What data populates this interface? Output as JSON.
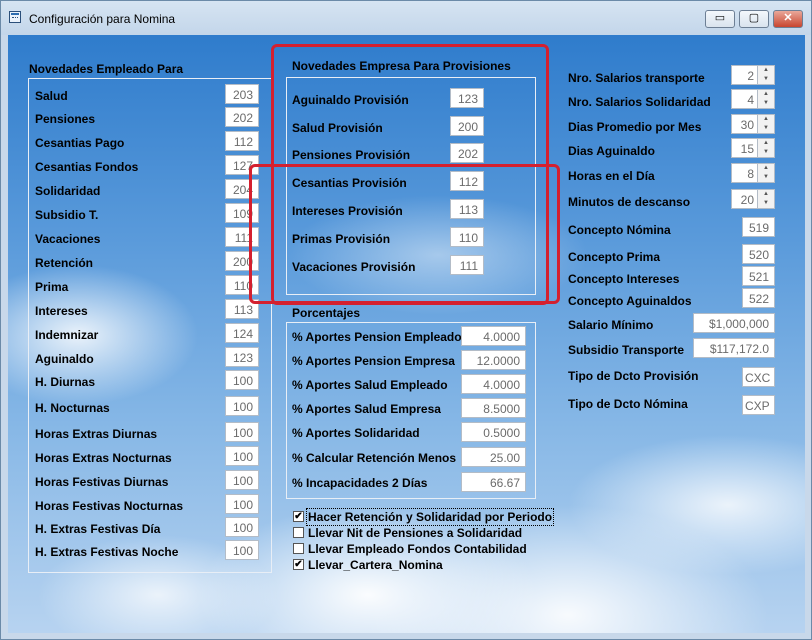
{
  "window": {
    "title": "Configuración para Nomina"
  },
  "empleado": {
    "title": "Novedades Empleado Para",
    "items": [
      {
        "label": "Salud",
        "value": "203"
      },
      {
        "label": "Pensiones",
        "value": "202"
      },
      {
        "label": "Cesantias Pago",
        "value": "112"
      },
      {
        "label": "Cesantias Fondos",
        "value": "127"
      },
      {
        "label": "Solidaridad",
        "value": "204"
      },
      {
        "label": "Subsidio T.",
        "value": "109"
      },
      {
        "label": "Vacaciones",
        "value": "111"
      },
      {
        "label": "Retención",
        "value": "200"
      },
      {
        "label": "Prima",
        "value": "110"
      },
      {
        "label": "Intereses",
        "value": "113"
      },
      {
        "label": "Indemnizar",
        "value": "124"
      },
      {
        "label": "Aguinaldo",
        "value": "123"
      },
      {
        "label": "H. Diurnas",
        "value": "100"
      },
      {
        "label": "H. Nocturnas",
        "value": "100"
      },
      {
        "label": "Horas Extras Diurnas",
        "value": "100"
      },
      {
        "label": "Horas Extras Nocturnas",
        "value": "100"
      },
      {
        "label": "Horas Festivas Diurnas",
        "value": "100"
      },
      {
        "label": "Horas Festivas Nocturnas",
        "value": "100"
      },
      {
        "label": "H. Extras Festivas Día",
        "value": "100"
      },
      {
        "label": "H. Extras Festivas Noche",
        "value": "100"
      }
    ]
  },
  "empresa": {
    "title": "Novedades Empresa Para Provisiones",
    "items": [
      {
        "label": "Aguinaldo Provisión",
        "value": "123"
      },
      {
        "label": "Salud Provisión",
        "value": "200"
      },
      {
        "label": "Pensiones Provisión",
        "value": "202"
      },
      {
        "label": "Cesantias Provisión",
        "value": "112"
      },
      {
        "label": "Intereses Provisión",
        "value": "113"
      },
      {
        "label": "Primas Provisión",
        "value": "110"
      },
      {
        "label": "Vacaciones Provisión",
        "value": "111"
      }
    ]
  },
  "porcentajes": {
    "title": "Porcentajes",
    "items": [
      {
        "label": "% Aportes Pension Empleado",
        "value": "4.0000"
      },
      {
        "label": "% Aportes Pension Empresa",
        "value": "12.0000"
      },
      {
        "label": "% Aportes Salud Empleado",
        "value": "4.0000"
      },
      {
        "label": "% Aportes Salud Empresa",
        "value": "8.5000"
      },
      {
        "label": "% Aportes Solidaridad",
        "value": "0.5000"
      },
      {
        "label": "% Calcular Retención Menos",
        "value": "25.00"
      },
      {
        "label": "% Incapacidades 2 Días",
        "value": "66.67"
      }
    ]
  },
  "checkboxes": [
    {
      "label": "Hacer Retención y Solidaridad por Periodo",
      "checked": true,
      "mark": "✔"
    },
    {
      "label": "Llevar Nit de Pensiones a Solidaridad",
      "checked": false,
      "mark": ""
    },
    {
      "label": "Llevar Empleado Fondos Contabilidad",
      "checked": false,
      "mark": ""
    },
    {
      "label": "Llevar_Cartera_Nomina",
      "checked": true,
      "mark": "✔"
    }
  ],
  "right": {
    "spinners": [
      {
        "label": "Nro. Salarios transporte",
        "value": "2"
      },
      {
        "label": "Nro. Salarios Solidaridad",
        "value": "4"
      },
      {
        "label": "Dias Promedio por Mes",
        "value": "30"
      },
      {
        "label": "Dias Aguinaldo",
        "value": "15"
      },
      {
        "label": "Horas en el Día",
        "value": "8"
      },
      {
        "label": "Minutos de descanso",
        "value": "20"
      }
    ],
    "conceptos": [
      {
        "label": "Concepto Nómina",
        "value": "519"
      },
      {
        "label": "Concepto Prima",
        "value": "520"
      },
      {
        "label": "Concepto Intereses",
        "value": "521"
      },
      {
        "label": "Concepto Aguinaldos",
        "value": "522"
      }
    ],
    "montos": [
      {
        "label": "Salario Mínimo",
        "value": "$1,000,000"
      },
      {
        "label": "Subsidio Transporte",
        "value": "$117,172.0"
      }
    ],
    "tipos": [
      {
        "label": "Tipo de Dcto Provisión",
        "value": "CXC"
      },
      {
        "label": "Tipo de Dcto Nómina",
        "value": "CXP"
      }
    ]
  },
  "icons": {
    "spin_up": "▲",
    "spin_down": "▼",
    "minimize": "▭",
    "maximize": "▢",
    "close": "✕"
  }
}
